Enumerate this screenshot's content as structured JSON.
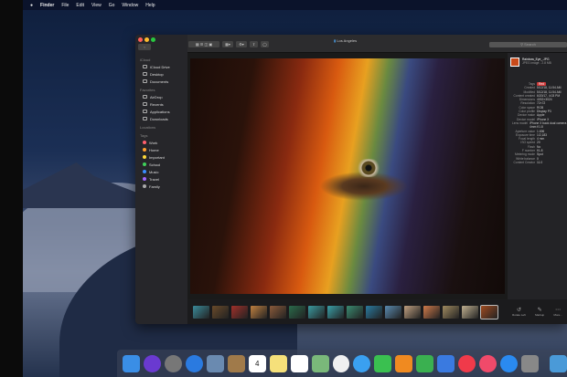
{
  "menubar": {
    "app": "Finder",
    "items": [
      "File",
      "Edit",
      "View",
      "Go",
      "Window",
      "Help"
    ]
  },
  "window": {
    "title": "Los Angeles",
    "search_placeholder": "Search"
  },
  "sidebar": {
    "icloud_header": "iCloud",
    "icloud": [
      "iCloud Drive",
      "Desktop",
      "Documents"
    ],
    "favorites_header": "Favorites",
    "favorites": [
      "AirDrop",
      "Recents",
      "Applications",
      "Downloads"
    ],
    "locations_header": "Locations",
    "tags_header": "Tags",
    "tags": [
      {
        "label": "Work",
        "color": "#ff5f6d"
      },
      {
        "label": "Home",
        "color": "#ff9f2e"
      },
      {
        "label": "Important",
        "color": "#ffd93a"
      },
      {
        "label": "School",
        "color": "#3fd05a"
      },
      {
        "label": "Music",
        "color": "#3a8dff"
      },
      {
        "label": "Travel",
        "color": "#a368ff"
      },
      {
        "label": "Family",
        "color": "#aaaaaa"
      }
    ]
  },
  "inspector": {
    "filename": "Rainbow_Eye_.JPG",
    "subtitle": "JPEG image - 2.8 MB",
    "rows": [
      [
        "Tags",
        "Red"
      ],
      [
        "Created",
        "5/12/18, 11:54 AM"
      ],
      [
        "Modified",
        "5/12/18, 11:54 AM"
      ],
      [
        "Content created",
        "6/20/17, 4:03 PM"
      ],
      [
        "Dimensions",
        "4032×3024"
      ],
      [
        "Resolution",
        "72×72"
      ],
      [
        "Color space",
        "RGB"
      ],
      [
        "Color profile",
        "Display P3"
      ],
      [
        "Device make",
        "Apple"
      ],
      [
        "Device model",
        "iPhone X"
      ],
      [
        "Lens model",
        "iPhone X back dual camera 4mm f/1.8"
      ],
      [
        "Aperture value",
        "1.696"
      ],
      [
        "Exposure time",
        "1/2,183"
      ],
      [
        "Focal length",
        "4 mm"
      ],
      [
        "ISO speed",
        "20"
      ],
      [
        "Flash",
        "No"
      ],
      [
        "F number",
        "f/1.8"
      ],
      [
        "Metering mode",
        "Spot"
      ],
      [
        "White balance",
        "0"
      ],
      [
        "Content Creator",
        "11.0"
      ]
    ]
  },
  "actions": [
    "Rotate Left",
    "Markup",
    "More..."
  ],
  "dock": [
    [
      "finder",
      "#3a8ee6"
    ],
    [
      "siri",
      "#6a3ad0"
    ],
    [
      "launchpad",
      "#777"
    ],
    [
      "safari",
      "#2a7ae0"
    ],
    [
      "mail-photo",
      "#6a8ab0"
    ],
    [
      "contacts",
      "#a07a4a"
    ],
    [
      "calendar",
      "#fff"
    ],
    [
      "notes",
      "#f5e07a"
    ],
    [
      "reminders",
      "#fff"
    ],
    [
      "maps",
      "#7ab87a"
    ],
    [
      "photos",
      "#f0f0f0"
    ],
    [
      "messages",
      "#3aa0f0"
    ],
    [
      "facetime",
      "#3ac050"
    ],
    [
      "pages",
      "#f08a20"
    ],
    [
      "numbers",
      "#3ab050"
    ],
    [
      "keynote",
      "#3a7ae0"
    ],
    [
      "news",
      "#f03a4a"
    ],
    [
      "music",
      "#f04a6a"
    ],
    [
      "app-store",
      "#2a8af0"
    ],
    [
      "system-preferences",
      "#888"
    ],
    [
      "downloads-folder",
      "#4a9ad8"
    ]
  ],
  "calendar_day": "4"
}
